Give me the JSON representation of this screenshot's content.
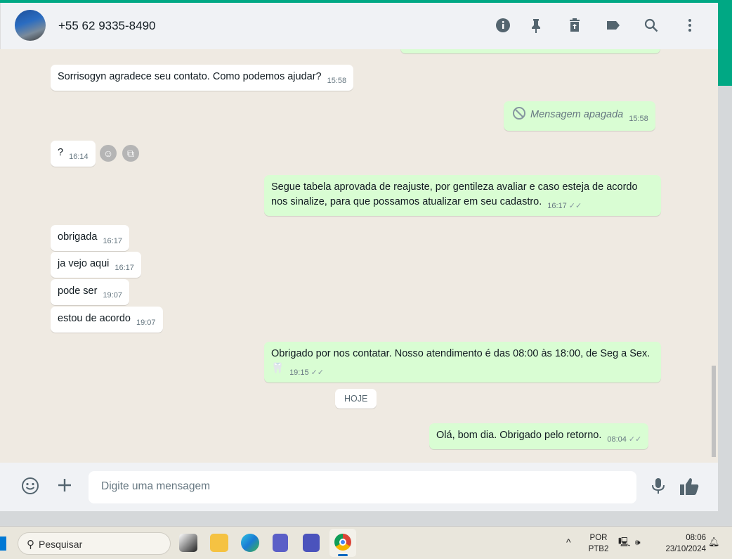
{
  "header": {
    "contact": "+55 62 9335-8490",
    "icons": [
      "info-icon",
      "pin-icon",
      "delete-icon",
      "label-icon",
      "search-icon",
      "menu-icon"
    ]
  },
  "messages": [
    {
      "dir": "in",
      "text": "Sorrisogyn agradece seu contato. Como podemos ajudar?",
      "time": "15:58"
    },
    {
      "dir": "out",
      "text": "Mensagem apagada",
      "time": "15:58",
      "deleted": true
    },
    {
      "dir": "in",
      "text": "?",
      "time": "16:14"
    },
    {
      "dir": "out",
      "text": "Segue tabela aprovada de reajuste, por gentileza avaliar e caso esteja de acordo nos sinalize, para que possamos atualizar em seu cadastro.",
      "time": "16:17"
    },
    {
      "dir": "in",
      "text": "obrigada",
      "time": "16:17"
    },
    {
      "dir": "in",
      "text": "ja vejo aqui",
      "time": "16:17"
    },
    {
      "dir": "in",
      "text": "pode ser",
      "time": "19:07"
    },
    {
      "dir": "in",
      "text": "estou de acordo",
      "time": "19:07"
    },
    {
      "dir": "out",
      "text": "Obrigado por nos contatar. Nosso atendimento é das 08:00 às 18:00, de Seg a Sex.🦷",
      "time": "19:15"
    },
    {
      "dir": "out",
      "text": "Olá, bom dia. Obrigado pelo retorno.",
      "time": "08:04"
    }
  ],
  "date_badge": "HOJE",
  "composer": {
    "placeholder": "Digite uma mensagem"
  },
  "taskbar": {
    "search": "Pesquisar",
    "lang1": "POR",
    "lang2": "PTB2",
    "time": "08:06",
    "date": "23/10/2024"
  },
  "colors": {
    "accent": "#00a884",
    "outgoing": "#d9fdd3",
    "chat_bg": "#efeae2"
  }
}
